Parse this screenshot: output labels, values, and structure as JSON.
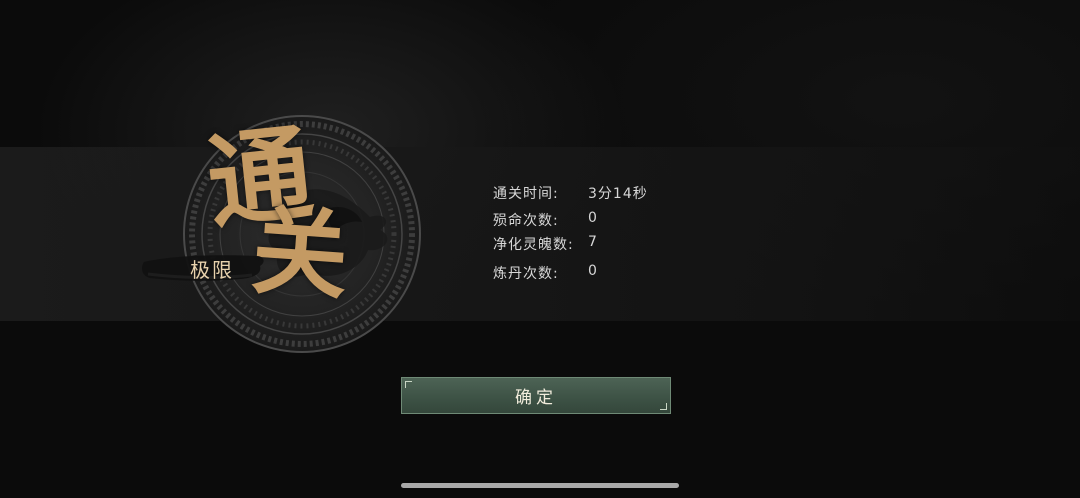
{
  "result": {
    "title_char_1": "通",
    "title_char_2": "关",
    "difficulty": "极限"
  },
  "stats": [
    {
      "label": "通关时间:",
      "value": "3分14秒"
    },
    {
      "label": "殒命次数:",
      "value": "0"
    },
    {
      "label": "净化灵魄数:",
      "value": "7"
    },
    {
      "label": "炼丹次数:",
      "value": "0"
    }
  ],
  "confirm": {
    "label": "确定"
  },
  "colors": {
    "gold": "#c49a63",
    "button": "#3e5346",
    "text": "#d7d7d7"
  }
}
